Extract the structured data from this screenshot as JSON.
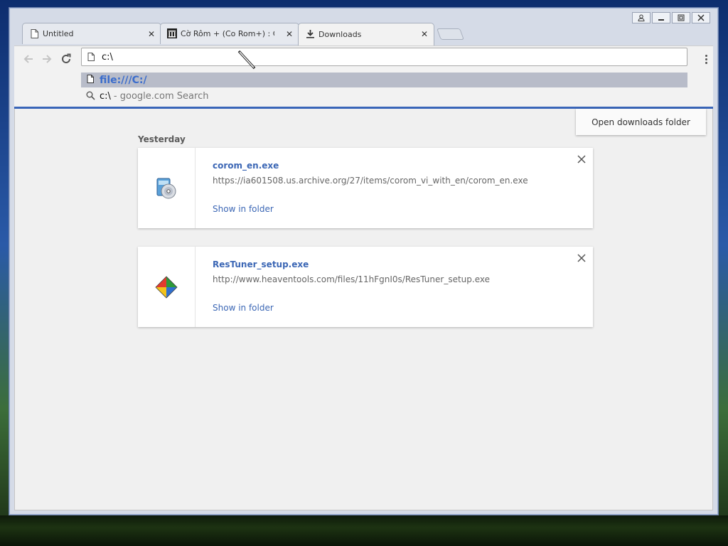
{
  "tabs": [
    {
      "title": "Untitled",
      "icon": "page-icon"
    },
    {
      "title": "Cờ Rôm + (Co Rom+) : Co",
      "icon": "archive-icon"
    },
    {
      "title": "Downloads",
      "icon": "download-icon"
    }
  ],
  "address_bar": {
    "value": "c:\\"
  },
  "suggestions": {
    "primary": "file:///C:/",
    "secondary_query": "c:\\",
    "secondary_desc": "- google.com Search"
  },
  "downloads": {
    "open_folder_label": "Open downloads folder",
    "date_heading": "Yesterday",
    "items": [
      {
        "filename": "corom_en.exe",
        "url": "https://ia601508.us.archive.org/27/items/corom_vi_with_en/corom_en.exe",
        "action": "Show in folder",
        "icon": "installer-cd-icon"
      },
      {
        "filename": "ResTuner_setup.exe",
        "url": "http://www.heaventools.com/files/11hFgnI0s/ResTuner_setup.exe",
        "action": "Show in folder",
        "icon": "restuner-app-icon"
      }
    ]
  },
  "colors": {
    "accent": "#3c67b5",
    "progress_bar": "#3965b8",
    "suggestion_highlight": "#b8bcc9"
  }
}
